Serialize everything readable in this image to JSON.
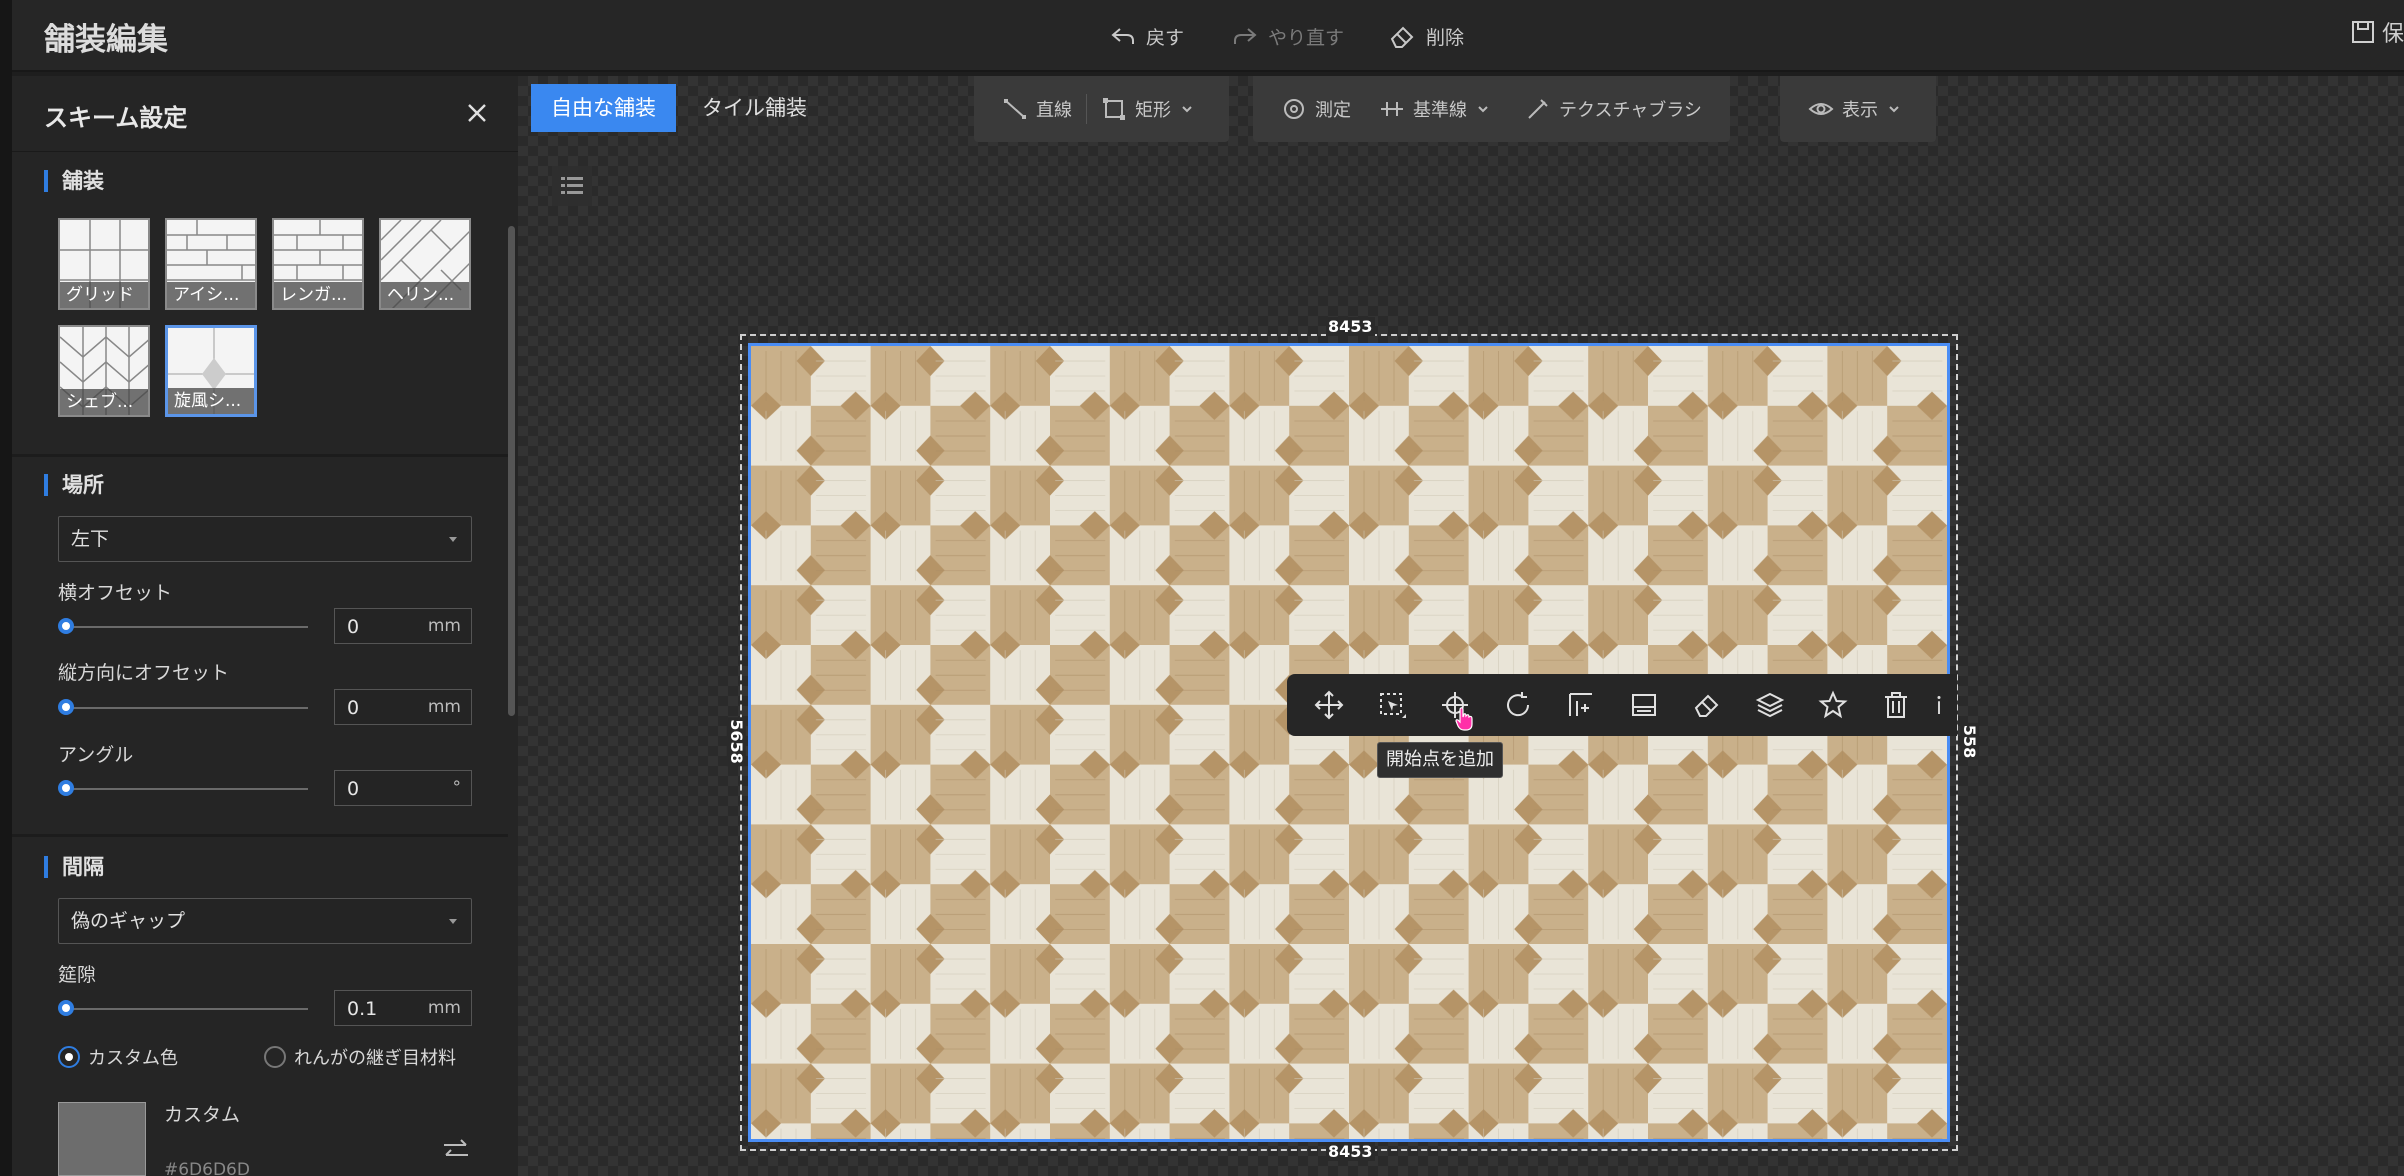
{
  "header": {
    "title": "舗装編集",
    "undo_label": "戻す",
    "redo_label": "やり直す",
    "delete_label": "削除",
    "save_label": "保"
  },
  "panel": {
    "title": "スキーム設定",
    "paving": {
      "title": "舗装",
      "tiles": [
        {
          "label": "グリッド",
          "icon": "grid-pattern-icon",
          "selected": false
        },
        {
          "label": "アイシ...",
          "icon": "ashlar-pattern-icon",
          "selected": false
        },
        {
          "label": "レンガ...",
          "icon": "brick-pattern-icon",
          "selected": false
        },
        {
          "label": "ヘリン...",
          "icon": "herringbone-pattern-icon",
          "selected": false
        },
        {
          "label": "シェブ...",
          "icon": "chevron-pattern-icon",
          "selected": false
        },
        {
          "label": "旋風シ...",
          "icon": "whirlwind-pattern-icon",
          "selected": true
        }
      ]
    },
    "location": {
      "title": "場所",
      "anchor_value": "左下",
      "h_offset": {
        "label": "横オフセット",
        "value": "0",
        "unit": "mm",
        "slider_level": 0
      },
      "v_offset": {
        "label": "縦方向にオフセット",
        "value": "0",
        "unit": "mm",
        "slider_level": 0
      },
      "angle": {
        "label": "アングル",
        "value": "0",
        "unit": "°",
        "slider_level": 0
      }
    },
    "spacing": {
      "title": "間隔",
      "gap_type_value": "偽のギャップ",
      "gap": {
        "label": "筵隙",
        "value": "0.1",
        "unit": "mm",
        "slider_level": 0
      },
      "radio_custom": "カスタム色",
      "radio_brick": "れんがの継ぎ目材料",
      "radio_selected": "custom",
      "custom_label": "カスタム",
      "custom_color_hex": "#6D6D6D",
      "swatch_color": "#6d6d6d"
    }
  },
  "canvas": {
    "mode_tabs": [
      "自由な舗装",
      "タイル舗装"
    ],
    "active_mode": 0,
    "tools_group1": [
      "直線",
      "矩形"
    ],
    "tools_group2": [
      "測定",
      "基準線",
      "テクスチャブラシ"
    ],
    "tools_group3": [
      "表示"
    ],
    "dimensions": {
      "top": "8453",
      "bottom": "8453",
      "left": "5658",
      "right": "558"
    },
    "floating_toolbar_icons": [
      "move-icon",
      "select-area-icon",
      "add-start-point-icon",
      "rotate-icon",
      "align-icon",
      "split-icon",
      "eraser-icon",
      "layers-icon",
      "favorite-icon",
      "delete-icon",
      "more-icon"
    ],
    "tooltip": "開始点を追加"
  },
  "colors": {
    "accent": "#2f7de1",
    "paving_light": "#e8e2d4",
    "paving_dark": "#c7ad83"
  }
}
